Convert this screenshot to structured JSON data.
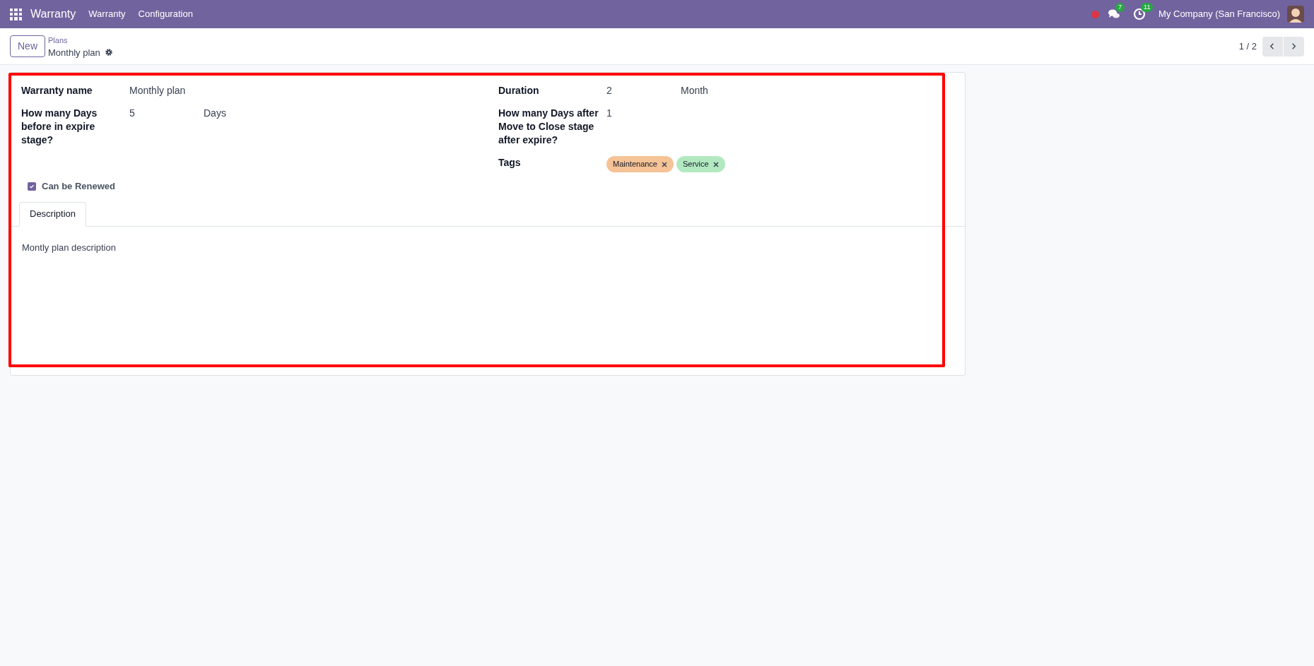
{
  "navbar": {
    "app_name": "Warranty",
    "menu": [
      "Warranty",
      "Configuration"
    ],
    "messages_count": "7",
    "activities_count": "11",
    "company": "My Company (San Francisco)"
  },
  "control_panel": {
    "new_button": "New",
    "breadcrumb": "Plans",
    "record_title": "Monthly plan",
    "pager": "1 / 2"
  },
  "form": {
    "left_fields": [
      {
        "label": "Warranty name",
        "value": "Monthly plan"
      },
      {
        "label": "How many Days before in expire stage?",
        "value": "5",
        "unit": "Days"
      }
    ],
    "right_fields": [
      {
        "label": "Duration",
        "value": "2",
        "unit": "Month"
      },
      {
        "label": "How many Days after Move to Close stage after expire?",
        "value": "1"
      }
    ],
    "tags_label": "Tags",
    "tags": [
      {
        "label": "Maintenance",
        "color": "#f5c396"
      },
      {
        "label": "Service",
        "color": "#b3e9c0"
      }
    ],
    "can_be_renewed": {
      "label": "Can be Renewed",
      "checked": true
    },
    "tabs": [
      {
        "label": "Description",
        "selected": true
      }
    ],
    "description": "Montly plan description"
  }
}
